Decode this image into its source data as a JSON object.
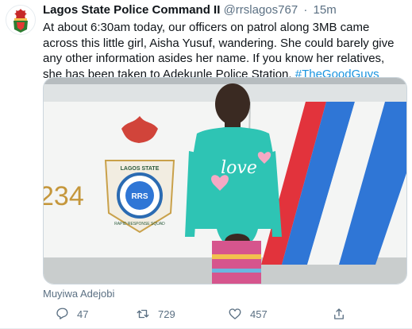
{
  "tweet": {
    "author_name": "Lagos State Police Command II",
    "handle": "@rrslagos767",
    "separator": "·",
    "time": "15m",
    "text": "At about 6:30am today, our officers on patrol along 3MB came across this little girl, Aisha Yusuf, wandering. She could barely give any other information asides her name. If you know her relatives, she has been taken to Adekunle Police Station.",
    "hashtag": "#TheGoodGuys",
    "photo_credit": "Muyiwa Adejobi",
    "photo_car_number": "234",
    "badge": {
      "top": "LAGOS STATE",
      "center": "RRS",
      "ring": "RAPID RESPONSE SQUAD"
    },
    "shirt_text": "love",
    "actions": {
      "replies": "47",
      "retweets": "729",
      "likes": "457"
    }
  },
  "icons": [
    "avatar-logo-icon",
    "reply-icon",
    "retweet-icon",
    "like-icon",
    "share-icon"
  ],
  "colors": {
    "link": "#1b95e0",
    "secondary_text": "#5b7083",
    "car_blue": "#2f76d6",
    "car_red": "#e2333c",
    "shirt_teal": "#2ec4b4"
  }
}
